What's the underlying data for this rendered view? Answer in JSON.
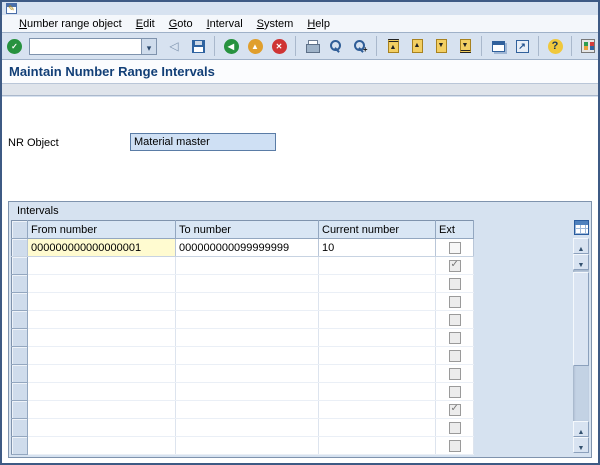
{
  "title": "Maintain Number Range Intervals",
  "menu": {
    "items": [
      "Number range object",
      "Edit",
      "Goto",
      "Interval",
      "System",
      "Help"
    ]
  },
  "toolbar": {
    "command_value": "",
    "icons": [
      {
        "name": "back-triangle-icon",
        "glyph": "◁",
        "cls": "i-backtri"
      },
      {
        "name": "save-icon",
        "cls": "i-floppy"
      },
      {
        "sep": true
      },
      {
        "name": "back-icon",
        "glyph": "◀",
        "cls": "i-circle c-green"
      },
      {
        "name": "exit-icon",
        "glyph": "▲",
        "cls": "i-circle c-yellow"
      },
      {
        "name": "cancel-icon",
        "glyph": "✕",
        "cls": "i-circle c-red"
      },
      {
        "sep": true
      },
      {
        "name": "print-icon",
        "cls": "i-print"
      },
      {
        "name": "find-icon",
        "cls": "i-find"
      },
      {
        "name": "find-next-icon",
        "glyph": "+",
        "cls": "i-find"
      },
      {
        "sep": true
      },
      {
        "name": "first-page-icon",
        "glyph": "▲",
        "cls": "i-page pg-first"
      },
      {
        "name": "previous-page-icon",
        "glyph": "▲",
        "cls": "i-page"
      },
      {
        "name": "next-page-icon",
        "glyph": "▼",
        "cls": "i-page"
      },
      {
        "name": "last-page-icon",
        "glyph": "▼",
        "cls": "i-page pg-last"
      },
      {
        "sep": true
      },
      {
        "name": "new-session-icon",
        "cls": "i-session"
      },
      {
        "name": "shortcut-icon",
        "glyph": "↗",
        "cls": "i-shortcut"
      },
      {
        "sep": true
      },
      {
        "name": "help-icon",
        "glyph": "?",
        "cls": "i-help"
      },
      {
        "sep": true
      },
      {
        "name": "customize-icon",
        "cls": "i-custom"
      }
    ]
  },
  "form": {
    "nr_object_label": "NR Object",
    "nr_object_value": "Material master"
  },
  "intervals": {
    "group_label": "Intervals",
    "columns": [
      "From number",
      "To number",
      "Current number",
      "Ext"
    ],
    "rows": [
      {
        "from": "000000000000000001",
        "to": "000000000099999999",
        "current": "10",
        "ext_checked": false
      },
      {
        "from": "",
        "to": "",
        "current": "",
        "ext_checked": true
      },
      {
        "from": "",
        "to": "",
        "current": "",
        "ext_checked": false
      },
      {
        "from": "",
        "to": "",
        "current": "",
        "ext_checked": false
      },
      {
        "from": "",
        "to": "",
        "current": "",
        "ext_checked": false
      },
      {
        "from": "",
        "to": "",
        "current": "",
        "ext_checked": false
      },
      {
        "from": "",
        "to": "",
        "current": "",
        "ext_checked": false
      },
      {
        "from": "",
        "to": "",
        "current": "",
        "ext_checked": false
      },
      {
        "from": "",
        "to": "",
        "current": "",
        "ext_checked": false
      },
      {
        "from": "",
        "to": "",
        "current": "",
        "ext_checked": true
      },
      {
        "from": "",
        "to": "",
        "current": "",
        "ext_checked": false
      },
      {
        "from": "",
        "to": "",
        "current": "",
        "ext_checked": false
      }
    ]
  },
  "colors": {
    "title_blue": "#123f77",
    "window_bg": "#d7e2f0",
    "field_blue": "#cfe0f4",
    "cell_yellow": "#fffbd0",
    "header_blue": "#d9e6f4"
  }
}
